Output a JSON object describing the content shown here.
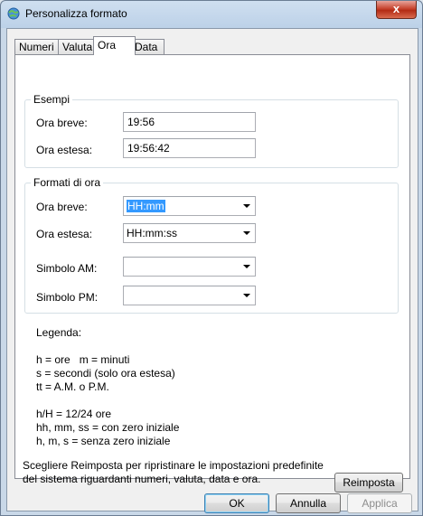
{
  "window": {
    "title": "Personalizza formato",
    "close_label": "x"
  },
  "tabs": [
    {
      "label": "Numeri"
    },
    {
      "label": "Valuta"
    },
    {
      "label": "Ora"
    },
    {
      "label": "Data"
    }
  ],
  "esempi": {
    "legend": "Esempi",
    "short_label": "Ora breve:",
    "short_value": "19:56",
    "long_label": "Ora estesa:",
    "long_value": "19:56:42"
  },
  "formati": {
    "legend": "Formati di ora",
    "short_label": "Ora breve:",
    "short_value": "HH:mm",
    "long_label": "Ora estesa:",
    "long_value": "HH:mm:ss",
    "am_label": "Simbolo AM:",
    "am_value": "",
    "pm_label": "Simbolo PM:",
    "pm_value": ""
  },
  "legenda": {
    "title": "Legenda:",
    "line1": "h = ore   m = minuti",
    "line2": "s = secondi (solo ora estesa)",
    "line3": "tt = A.M. o P.M.",
    "line4": "h/H = 12/24 ore",
    "line5": "hh, mm, ss = con zero iniziale",
    "line6": "h, m, s = senza zero iniziale"
  },
  "reset": {
    "text1": "Scegliere Reimposta per ripristinare le impostazioni predefinite",
    "text2": "del sistema riguardanti numeri, valuta, data e ora.",
    "button": "Reimposta"
  },
  "buttons": {
    "ok": "OK",
    "cancel": "Annulla",
    "apply": "Applica"
  }
}
